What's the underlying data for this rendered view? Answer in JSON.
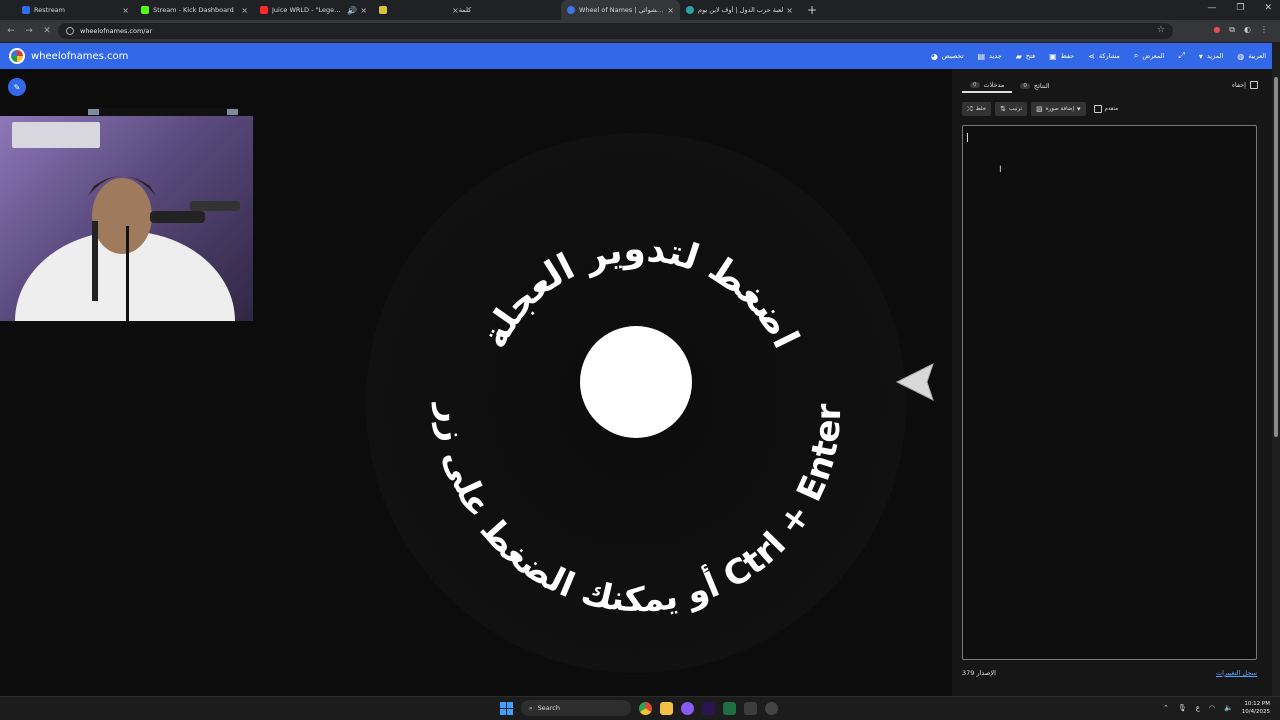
{
  "browser": {
    "tabs": [
      {
        "title": "Restream",
        "color": "#2f6fed",
        "active": false
      },
      {
        "title": "Stream - Kick Dashboard",
        "color": "#53fc18",
        "active": false
      },
      {
        "title": "Juice WRLD - \"Legends\" (O",
        "color": "#ff2a2a",
        "active": false
      },
      {
        "title": "",
        "color": "#d6c43c",
        "active": false
      },
      {
        "title": "كلمة",
        "color": "#555555",
        "active": false
      },
      {
        "title": "Wheel of Names | دولاب الاسم العشوائي",
        "color": "#3f73e6",
        "active": true
      },
      {
        "title": "لعبة حرب الدول | أوف لاين يوم",
        "color": "#2aa3a3",
        "active": false
      }
    ],
    "url": "wheelofnames.com/ar",
    "new_tab_label": "+"
  },
  "app": {
    "brand": "wheelofnames.com",
    "menu": [
      {
        "label": "تخصيص",
        "icon": "palette-icon"
      },
      {
        "label": "جديد",
        "icon": "new-file-icon"
      },
      {
        "label": "فتح",
        "icon": "folder-icon"
      },
      {
        "label": "حفظ",
        "icon": "save-icon"
      },
      {
        "label": "مشاركة",
        "icon": "share-icon"
      },
      {
        "label": "المعرض",
        "icon": "search-icon"
      },
      {
        "label": "",
        "icon": "fullscreen-icon"
      },
      {
        "label": "المزيد",
        "icon": "chevron-down-icon"
      },
      {
        "label": "العربية",
        "icon": "globe-icon"
      }
    ]
  },
  "wheel": {
    "text_top": "اضغط لتدوير العجلة",
    "text_bottom": "أو يمكنك الضغط على زر Ctrl + Enter"
  },
  "panel": {
    "tab_entries": {
      "label": "مدخلات",
      "count": "0"
    },
    "tab_results": {
      "label": "النتائج",
      "count": "0"
    },
    "hide_label": "إخفاء",
    "shuffle_label": "خلط",
    "sort_label": "ترتيب",
    "add_image_label": "إضافة صورة",
    "advanced_label": "متقدم",
    "version_label": "الإصدار 379",
    "changelog_label": "سجل التغييرات"
  },
  "taskbar": {
    "search_label": "Search",
    "lang": "ع",
    "time": "10:12 PM",
    "date": "10/4/2025"
  },
  "colors": {
    "accent": "#3369e8",
    "wheel_bg": "#0c0c0c",
    "pointer": "#d9d9d9"
  }
}
